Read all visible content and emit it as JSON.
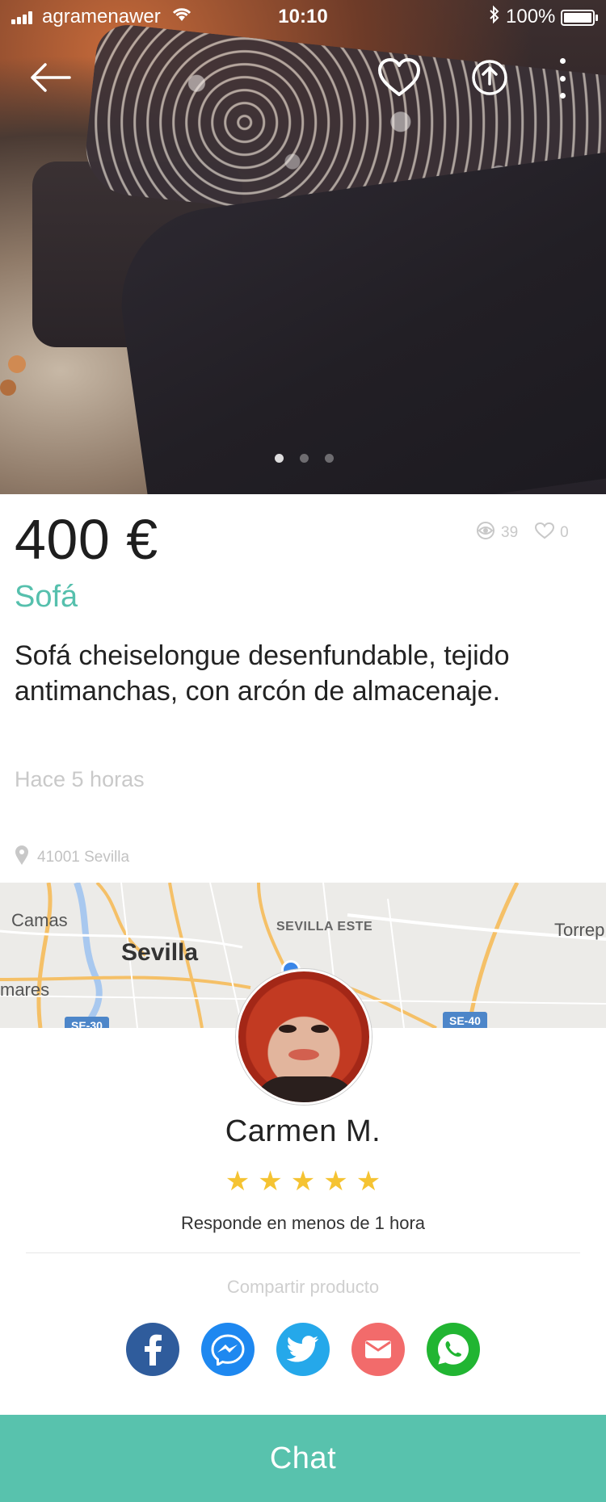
{
  "status_bar": {
    "carrier": "agramenawer",
    "time": "10:10",
    "battery": "100%"
  },
  "icons": {
    "back": "arrow-left-icon",
    "favorite": "heart-icon",
    "share": "share-upload-icon",
    "more": "more-vertical-icon",
    "views": "eye-icon",
    "likes": "heart-outline-icon",
    "location": "location-pin-icon"
  },
  "gallery": {
    "count": 3,
    "active_index": 0
  },
  "product": {
    "price": "400 €",
    "views": "39",
    "likes": "0",
    "title": "Sofá",
    "description": "Sofá cheiselongue desenfundable, tejido antimanchas, con arcón de almacenaje.",
    "posted": "Hace 5 horas",
    "location": "41001 Sevilla"
  },
  "map": {
    "labels": {
      "camas": "Camas",
      "sevilla": "Sevilla",
      "sevilla_este": "SEVILLA ESTE",
      "torrep": "Torrep",
      "mares": "mares"
    },
    "roads": {
      "se30": "SE-30",
      "se40": "SE-40"
    }
  },
  "seller": {
    "name": "Carmen M.",
    "rating": 5,
    "rating_max": 5,
    "response": "Responde en menos de 1 hora"
  },
  "share": {
    "title": "Compartir producto",
    "colors": {
      "facebook": "#2f5c9c",
      "messenger": "#1e88f0",
      "twitter": "#25a8ea",
      "email": "#f26b6b",
      "whatsapp": "#21b532"
    }
  },
  "chat": {
    "label": "Chat",
    "color": "#58c2ad"
  }
}
